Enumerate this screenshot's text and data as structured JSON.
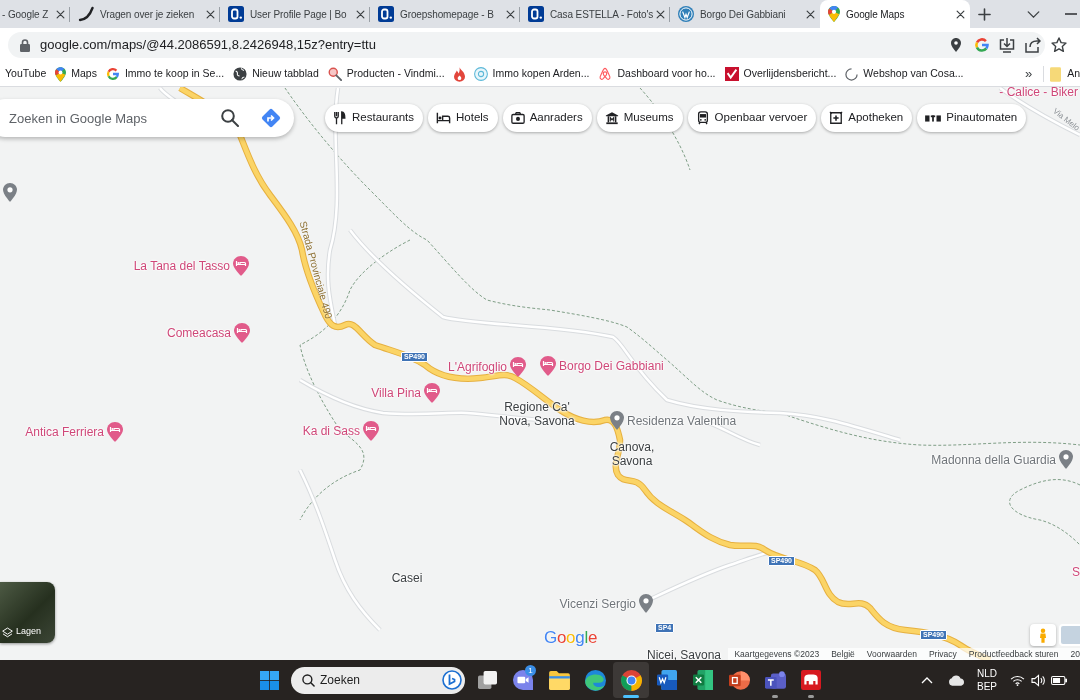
{
  "browser": {
    "tabs": [
      {
        "kind": "none",
        "title": "- Google Z",
        "selected": false
      },
      {
        "kind": "swoosh",
        "title": "Vragen over je zieken",
        "selected": false
      },
      {
        "kind": "tile",
        "title": "User Profile Page | Bo",
        "selected": false
      },
      {
        "kind": "tile",
        "title": "Groepshomepage - B",
        "selected": false
      },
      {
        "kind": "tile",
        "title": "Casa ESTELLA - Foto's",
        "selected": false
      },
      {
        "kind": "circle_logo",
        "title": "Borgo Dei Gabbiani",
        "selected": false
      },
      {
        "kind": "map_pin",
        "title": "Google Maps",
        "selected": true
      }
    ],
    "address_bar": {
      "url": "google.com/maps/@44.2086591,8.2426948,15z?entry=ttu"
    },
    "bookmarks": [
      {
        "kind": "none",
        "label": "YouTube"
      },
      {
        "kind": "map_pin",
        "label": "Maps"
      },
      {
        "kind": "g_logo",
        "label": "Immo te koop in Se..."
      },
      {
        "kind": "globe",
        "label": "Nieuw tabblad"
      },
      {
        "kind": "magnifier",
        "label": "Producten - Vindmi..."
      },
      {
        "kind": "flame"
      },
      {
        "kind": "ring",
        "label": "Immo kopen Arden..."
      },
      {
        "kind": "loop",
        "label": "Dashboard voor ho..."
      },
      {
        "kind": "check_tile",
        "label": "Overlijdensbericht..."
      },
      {
        "kind": "spinner",
        "label": "Webshop van Cosa..."
      }
    ],
    "bookmarks_overflow": "»",
    "bookmark_folder": {
      "label": "An"
    }
  },
  "map": {
    "search": {
      "placeholder": "Zoeken in Google Maps"
    },
    "chips": [
      {
        "kind": "restaurant",
        "label": "Restaurants"
      },
      {
        "kind": "hotel",
        "label": "Hotels"
      },
      {
        "kind": "camera",
        "label": "Aanraders"
      },
      {
        "kind": "museum",
        "label": "Museums"
      },
      {
        "kind": "transit",
        "label": "Openbaar vervoer"
      },
      {
        "kind": "pharmacy",
        "label": "Apotheken"
      },
      {
        "kind": "atm",
        "label": "Pinautomaten"
      }
    ],
    "places": [
      {
        "kind": "lodging",
        "name": "- Calice - Biker"
      },
      {
        "kind": "poi"
      },
      {
        "kind": "lodging",
        "name": "La Tana del Tasso"
      },
      {
        "kind": "lodging",
        "name": "Comeacasa"
      },
      {
        "kind": "lodging",
        "name": "L'Agrifoglio"
      },
      {
        "kind": "lodging",
        "name": "Borgo Dei Gabbiani"
      },
      {
        "kind": "lodging",
        "name": "Villa Pina"
      },
      {
        "kind": "locality",
        "name": "Regione Ca' Nova, Savona"
      },
      {
        "kind": "poi",
        "name": "Residenza Valentina"
      },
      {
        "kind": "lodging",
        "name": "Ka di Sass"
      },
      {
        "kind": "lodging",
        "name": "Antica Ferriera"
      },
      {
        "kind": "locality",
        "name": "Canova, Savona"
      },
      {
        "kind": "poi",
        "name": "Madonna della Guardia"
      },
      {
        "kind": "lodging",
        "name": "S"
      },
      {
        "kind": "locality",
        "name": "Casei"
      },
      {
        "kind": "poi",
        "name": "Vicenzi Sergio"
      },
      {
        "kind": "locality",
        "name": "Nicei, Savona"
      }
    ],
    "road_shields": [
      "SP490",
      "SP490",
      "SP490",
      "SP4"
    ],
    "road_labels": [
      "Strada Provinciale 490",
      "Via Melo"
    ],
    "layers_button": {
      "label": "Lagen"
    },
    "logo": "Google",
    "attribution": [
      "Kaartgegevens ©2023",
      "België",
      "Voorwaarden",
      "Privacy",
      "Productfeedback sturen",
      "20"
    ]
  },
  "taskbar": {
    "search": {
      "placeholder": "Zoeken"
    },
    "apps": [
      {
        "kind": "start",
        "running": false,
        "active": false
      },
      {
        "kind": "task_view",
        "running": false,
        "active": false
      },
      {
        "kind": "chat",
        "running": false,
        "active": false,
        "badge": "1"
      },
      {
        "kind": "files",
        "running": false,
        "active": false
      },
      {
        "kind": "swirl",
        "running": false,
        "active": false
      },
      {
        "kind": "browser",
        "running": true,
        "active": true
      },
      {
        "kind": "document",
        "running": false,
        "active": false
      },
      {
        "kind": "spreadsheet",
        "running": false,
        "active": false
      },
      {
        "kind": "presentation",
        "running": false,
        "active": false
      },
      {
        "kind": "people",
        "running": true,
        "active": false
      },
      {
        "kind": "red_app",
        "running": true,
        "active": false
      }
    ],
    "input_indicator": [
      "NLD",
      "BEP"
    ]
  }
}
